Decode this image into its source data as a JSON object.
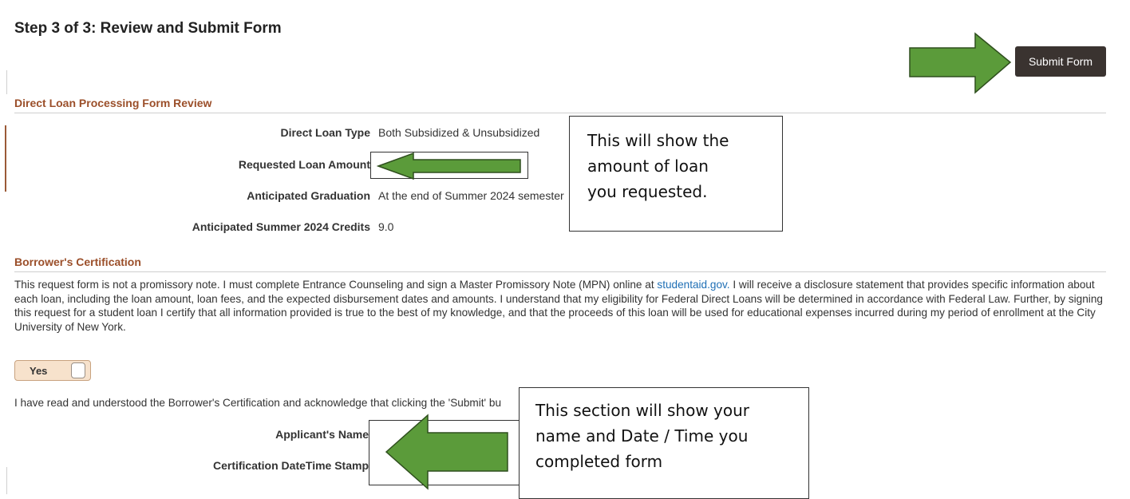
{
  "page": {
    "title": "Step 3 of 3: Review and Submit Form",
    "submit_label": "Submit Form"
  },
  "review": {
    "section_title": "Direct Loan Processing Form Review",
    "fields": [
      {
        "label": "Direct Loan Type",
        "value": "Both Subsidized & Unsubsidized"
      },
      {
        "label": "Requested Loan Amount",
        "value": ""
      },
      {
        "label": "Anticipated Graduation",
        "value": "At the end of Summer 2024 semester"
      },
      {
        "label": "Anticipated Summer 2024 Credits",
        "value": "9.0"
      }
    ]
  },
  "certification": {
    "section_title": "Borrower's Certification",
    "text_before_link": "This request form is not a promissory note. I must complete Entrance Counseling and sign a Master Promissory Note (MPN) online at ",
    "link_text": "studentaid.gov.",
    "text_after_link": " I will receive a disclosure statement that provides specific information about each loan, including the loan amount, loan fees, and the expected disbursement dates and amounts. I understand that my eligibility for Federal Direct Loans will be determined in accordance with Federal Law. Further, by signing this request for a student loan I certify that all information provided is true to the best of my knowledge, and that the proceeds of this loan will be used for educational expenses incurred during my period of enrollment at the City University of New York.",
    "yes_label": "Yes",
    "acknowledge_text": "I have read and understood the Borrower's Certification and acknowledge that clicking the 'Submit' bu",
    "applicant_name_label": "Applicant's Name",
    "timestamp_label": "Certification DateTime Stamp"
  },
  "annotations": {
    "callout_amount": [
      "This will show the",
      "amount of loan",
      "you requested."
    ],
    "callout_name": [
      "This section will show your",
      "name and Date / Time you",
      "completed form"
    ],
    "arrow_color": "#5b9b3a",
    "arrow_outline": "#2f4f1e"
  },
  "colors": {
    "section_title": "#9b4f2a",
    "submit_bg": "#3a3330",
    "toggle_bg": "#f7e2cc",
    "link": "#1f6fb5"
  }
}
